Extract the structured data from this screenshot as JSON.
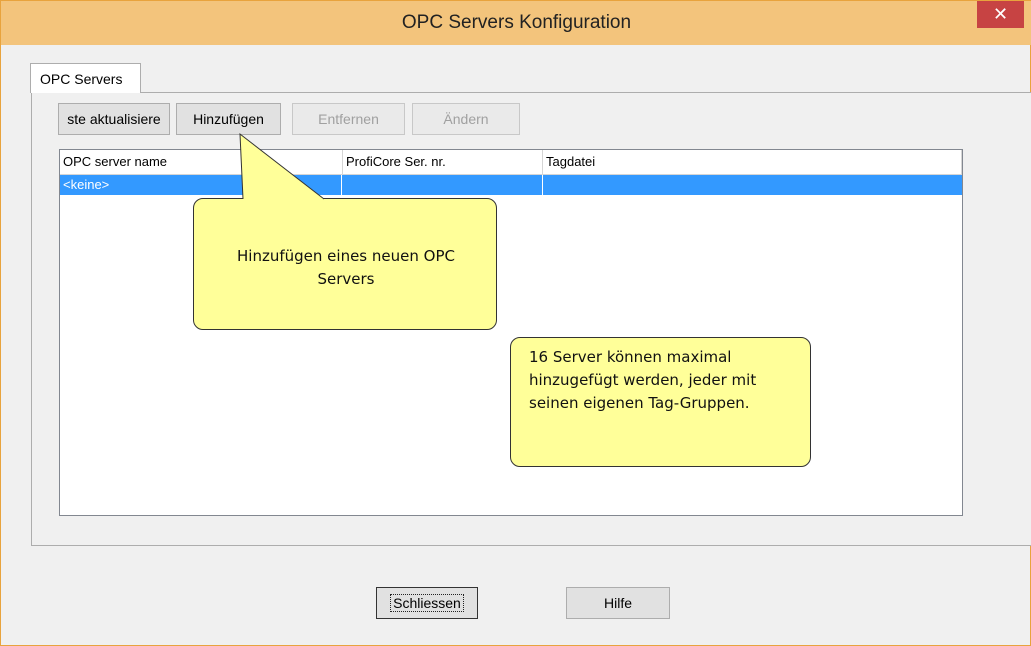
{
  "window": {
    "title": "OPC Servers Konfiguration",
    "close_symbol": "✕"
  },
  "tabs": [
    {
      "label": "OPC Servers"
    }
  ],
  "toolbar": {
    "refresh_label": "ste aktualisiere",
    "add_label": "Hinzufügen",
    "remove_label": "Entfernen",
    "edit_label": "Ändern"
  },
  "server_list": {
    "columns": [
      "OPC server name",
      "ProfiCore Ser. nr.",
      "Tagdatei"
    ],
    "rows": [
      {
        "name": "<keine>",
        "serial": "",
        "tagfile": ""
      }
    ]
  },
  "callouts": {
    "add_tip": "Hinzufügen eines neuen OPC Servers",
    "limit_tip": "16 Server können maximal hinzugefügt werden, jeder mit seinen eigenen Tag-Gruppen."
  },
  "footer": {
    "close_label": "Schliessen",
    "help_label": "Hilfe"
  },
  "colors": {
    "titlebar": "#f3c47c",
    "selection": "#3399ff",
    "callout_fill": "#ffff99",
    "close_button": "#c74343"
  }
}
